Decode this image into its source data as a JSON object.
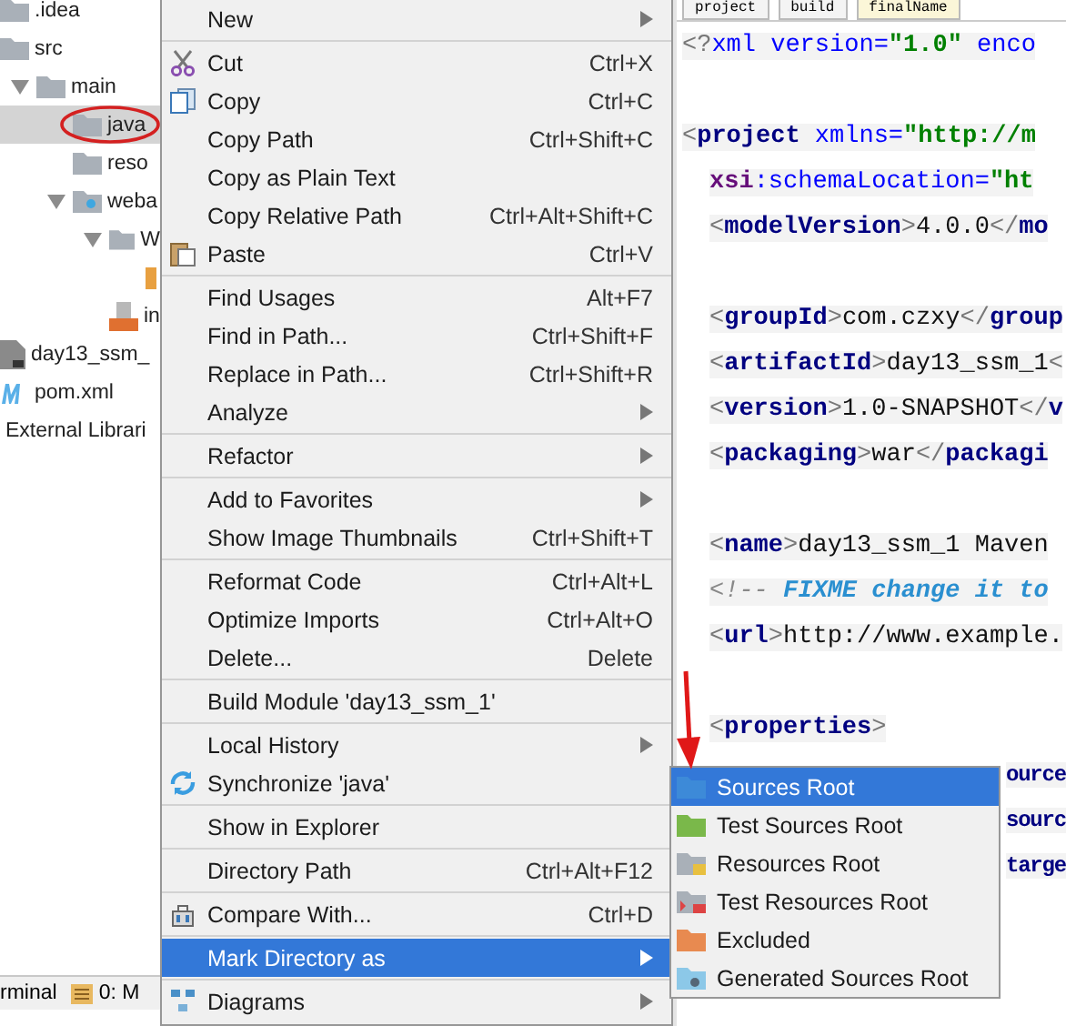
{
  "tree": [
    {
      "label": ".idea",
      "kind": "folder"
    },
    {
      "label": "src",
      "kind": "folder",
      "children": [
        {
          "label": "main",
          "kind": "folder",
          "expanded": true,
          "children": [
            {
              "label": "java",
              "kind": "folder",
              "selected": true
            },
            {
              "label": "reso",
              "kind": "folder"
            },
            {
              "label": "weba",
              "kind": "web-folder",
              "expanded": true,
              "children": [
                {
                  "label": "W",
                  "kind": "folder",
                  "expanded": true,
                  "children": [
                    {
                      "kind": "file"
                    }
                  ]
                },
                {
                  "label": "in",
                  "kind": "jsp"
                }
              ]
            }
          ]
        }
      ]
    },
    {
      "label": "day13_ssm_",
      "kind": "module"
    },
    {
      "label": "pom.xml",
      "kind": "maven"
    },
    {
      "label": "External Librari",
      "kind": "plain"
    }
  ],
  "bottom_bar": [
    {
      "label": "rminal",
      "kind": "plain"
    },
    {
      "label": "0: M",
      "kind": "list"
    }
  ],
  "context_menu": [
    {
      "kind": "item",
      "label": "New",
      "submenu": true,
      "selected": false
    },
    {
      "kind": "separator"
    },
    {
      "kind": "scissors",
      "label": "Cut",
      "shortcut": "Ctrl+X",
      "submenu": false,
      "selected": false
    },
    {
      "kind": "copy",
      "label": "Copy",
      "shortcut": "Ctrl+C",
      "submenu": false,
      "selected": false
    },
    {
      "kind": "item",
      "label": "Copy Path",
      "shortcut": "Ctrl+Shift+C",
      "submenu": false,
      "selected": false
    },
    {
      "kind": "item",
      "label": "Copy as Plain Text",
      "submenu": false,
      "selected": false
    },
    {
      "kind": "item",
      "label": "Copy Relative Path",
      "shortcut": "Ctrl+Alt+Shift+C",
      "submenu": false,
      "selected": false
    },
    {
      "kind": "paste",
      "label": "Paste",
      "shortcut": "Ctrl+V",
      "submenu": false,
      "selected": false
    },
    {
      "kind": "separator"
    },
    {
      "kind": "item",
      "label": "Find Usages",
      "shortcut": "Alt+F7",
      "submenu": false,
      "selected": false
    },
    {
      "kind": "item",
      "label": "Find in Path...",
      "shortcut": "Ctrl+Shift+F",
      "submenu": false,
      "selected": false
    },
    {
      "kind": "item",
      "label": "Replace in Path...",
      "shortcut": "Ctrl+Shift+R",
      "submenu": false,
      "selected": false
    },
    {
      "kind": "item",
      "label": "Analyze",
      "submenu": true,
      "selected": false
    },
    {
      "kind": "separator"
    },
    {
      "kind": "item",
      "label": "Refactor",
      "submenu": true,
      "selected": false
    },
    {
      "kind": "separator"
    },
    {
      "kind": "item",
      "label": "Add to Favorites",
      "submenu": true,
      "selected": false
    },
    {
      "kind": "item",
      "label": "Show Image Thumbnails",
      "shortcut": "Ctrl+Shift+T",
      "submenu": false,
      "selected": false
    },
    {
      "kind": "separator"
    },
    {
      "kind": "item",
      "label": "Reformat Code",
      "shortcut": "Ctrl+Alt+L",
      "submenu": false,
      "selected": false
    },
    {
      "kind": "item",
      "label": "Optimize Imports",
      "shortcut": "Ctrl+Alt+O",
      "submenu": false,
      "selected": false
    },
    {
      "kind": "item",
      "label": "Delete...",
      "shortcut": "Delete",
      "submenu": false,
      "selected": false
    },
    {
      "kind": "separator"
    },
    {
      "kind": "item",
      "label": "Build Module 'day13_ssm_1'",
      "submenu": false,
      "selected": false
    },
    {
      "kind": "separator"
    },
    {
      "kind": "item",
      "label": "Local History",
      "submenu": true,
      "selected": false
    },
    {
      "kind": "sync",
      "label": "Synchronize 'java'",
      "submenu": false,
      "selected": false
    },
    {
      "kind": "separator"
    },
    {
      "kind": "item",
      "label": "Show in Explorer",
      "submenu": false,
      "selected": false
    },
    {
      "kind": "separator"
    },
    {
      "kind": "item",
      "label": "Directory Path",
      "shortcut": "Ctrl+Alt+F12",
      "submenu": false,
      "selected": false
    },
    {
      "kind": "separator"
    },
    {
      "kind": "compare",
      "label": "Compare With...",
      "shortcut": "Ctrl+D",
      "submenu": false,
      "selected": false
    },
    {
      "kind": "separator"
    },
    {
      "kind": "item",
      "label": "Mark Directory as",
      "submenu": true,
      "selected": true
    },
    {
      "kind": "separator"
    },
    {
      "kind": "diagram",
      "label": "Diagrams",
      "submenu": true,
      "selected": false
    }
  ],
  "submenu": [
    {
      "label": "Sources Root",
      "kind": "sources",
      "selected": true
    },
    {
      "label": "Test Sources Root",
      "kind": "test-sources",
      "selected": false
    },
    {
      "label": "Resources Root",
      "kind": "resources",
      "selected": false
    },
    {
      "label": "Test Resources Root",
      "kind": "test-resources",
      "selected": false
    },
    {
      "label": "Excluded",
      "kind": "excluded",
      "selected": false
    },
    {
      "label": "Generated Sources Root",
      "kind": "generated",
      "selected": false
    }
  ],
  "editor_tabs": [
    {
      "label": "project",
      "selected": false
    },
    {
      "label": "build",
      "selected": false
    },
    {
      "label": "finalName",
      "selected": true
    }
  ],
  "code_lines": [
    {
      "kind": "code",
      "tokens": [
        {
          "kind": "punct",
          "text": "<?"
        },
        {
          "kind": "attr",
          "text": "xml version="
        },
        {
          "kind": "value",
          "text": "\"1.0\""
        },
        {
          "kind": "attr",
          "text": " enco"
        }
      ]
    },
    {
      "kind": "blank"
    },
    {
      "kind": "code",
      "tokens": [
        {
          "kind": "punct",
          "text": "<"
        },
        {
          "kind": "tag",
          "text": "project"
        },
        {
          "kind": "attr",
          "text": " xmlns="
        },
        {
          "kind": "value",
          "text": "\"http://m"
        }
      ]
    },
    {
      "kind": "indented",
      "tokens": [
        {
          "kind": "ns",
          "text": "xsi"
        },
        {
          "kind": "attr",
          "text": ":schemaLocation="
        },
        {
          "kind": "value",
          "text": "\"ht"
        }
      ]
    },
    {
      "kind": "indented",
      "tokens": [
        {
          "kind": "punct",
          "text": "<"
        },
        {
          "kind": "tag",
          "text": "modelVersion"
        },
        {
          "kind": "punct",
          "text": ">"
        },
        {
          "kind": "text",
          "text": "4.0.0"
        },
        {
          "kind": "punct",
          "text": "</"
        },
        {
          "kind": "tag",
          "text": "mo"
        }
      ]
    },
    {
      "kind": "blank"
    },
    {
      "kind": "indented",
      "tokens": [
        {
          "kind": "punct",
          "text": "<"
        },
        {
          "kind": "tag",
          "text": "groupId"
        },
        {
          "kind": "punct",
          "text": ">"
        },
        {
          "kind": "text",
          "text": "com.czxy"
        },
        {
          "kind": "punct",
          "text": "</"
        },
        {
          "kind": "tag",
          "text": "group"
        }
      ]
    },
    {
      "kind": "indented",
      "tokens": [
        {
          "kind": "punct",
          "text": "<"
        },
        {
          "kind": "tag",
          "text": "artifactId"
        },
        {
          "kind": "punct",
          "text": ">"
        },
        {
          "kind": "text",
          "text": "day13_ssm_1"
        },
        {
          "kind": "punct",
          "text": "<"
        }
      ]
    },
    {
      "kind": "indented",
      "tokens": [
        {
          "kind": "punct",
          "text": "<"
        },
        {
          "kind": "tag",
          "text": "version"
        },
        {
          "kind": "punct",
          "text": ">"
        },
        {
          "kind": "text",
          "text": "1.0-SNAPSHOT"
        },
        {
          "kind": "punct",
          "text": "</"
        },
        {
          "kind": "tag",
          "text": "v"
        }
      ]
    },
    {
      "kind": "indented",
      "tokens": [
        {
          "kind": "punct",
          "text": "<"
        },
        {
          "kind": "tag",
          "text": "packaging"
        },
        {
          "kind": "punct",
          "text": ">"
        },
        {
          "kind": "text",
          "text": "war"
        },
        {
          "kind": "punct",
          "text": "</"
        },
        {
          "kind": "tag",
          "text": "packagi"
        }
      ]
    },
    {
      "kind": "blank"
    },
    {
      "kind": "indented",
      "tokens": [
        {
          "kind": "punct",
          "text": "<"
        },
        {
          "kind": "tag",
          "text": "name"
        },
        {
          "kind": "punct",
          "text": ">"
        },
        {
          "kind": "text",
          "text": "day13_ssm_1 Maven"
        }
      ]
    },
    {
      "kind": "indented",
      "tokens": [
        {
          "kind": "comment",
          "text": "<!-- "
        },
        {
          "kind": "fixme",
          "text": "FIXME change it to"
        }
      ]
    },
    {
      "kind": "indented",
      "tokens": [
        {
          "kind": "punct",
          "text": "<"
        },
        {
          "kind": "tag",
          "text": "url"
        },
        {
          "kind": "punct",
          "text": ">"
        },
        {
          "kind": "text",
          "text": "http://www.example."
        }
      ]
    },
    {
      "kind": "blank"
    },
    {
      "kind": "indented",
      "tokens": [
        {
          "kind": "punct",
          "text": "<"
        },
        {
          "kind": "tag",
          "text": "properties"
        },
        {
          "kind": "punct",
          "text": ">"
        }
      ]
    },
    {
      "kind": "tail",
      "tokens": [
        {
          "kind": "tag",
          "text": "ource"
        }
      ]
    },
    {
      "kind": "tail",
      "tokens": [
        {
          "kind": "tag",
          "text": "sourc"
        }
      ]
    },
    {
      "kind": "tail",
      "tokens": [
        {
          "kind": "tag",
          "text": "targe"
        }
      ]
    }
  ]
}
